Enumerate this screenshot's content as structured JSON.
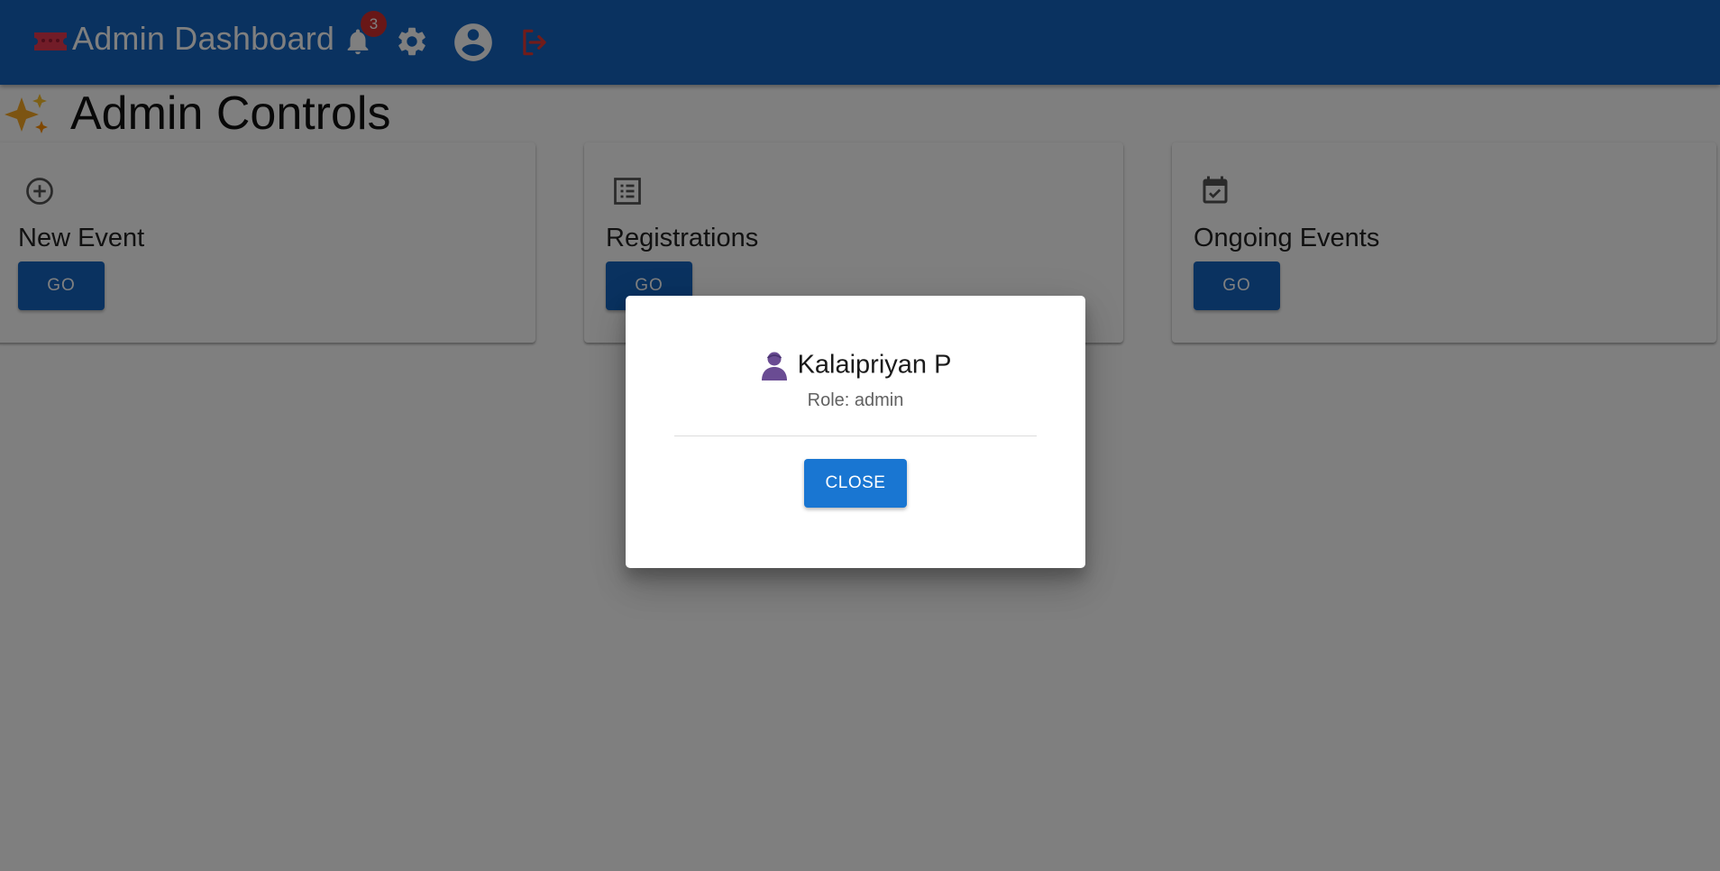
{
  "header": {
    "title": "Admin Dashboard",
    "notification_count": "3",
    "icons": [
      "ticket-icon",
      "bell-icon",
      "gear-icon",
      "account-circle-icon",
      "logout-icon"
    ],
    "colors": {
      "app_bar": "#1565c0",
      "badge": "#d32f2f",
      "logout": "#c62828"
    }
  },
  "main": {
    "heading": "Admin Controls",
    "heading_icon": "sparkles-icon",
    "cards": [
      {
        "title": "New Event",
        "icon": "add-circle-icon",
        "button": "GO"
      },
      {
        "title": "Registrations",
        "icon": "list-icon",
        "button": "GO"
      },
      {
        "title": "Ongoing Events",
        "icon": "calendar-check-icon",
        "button": "GO"
      }
    ]
  },
  "dialog": {
    "user_icon": "person-icon",
    "name": "Kalaipriyan P",
    "role": "Role: admin",
    "close_label": "CLOSE",
    "colors": {
      "close_button": "#1976d2",
      "person_icon": "#6a4c93"
    }
  }
}
